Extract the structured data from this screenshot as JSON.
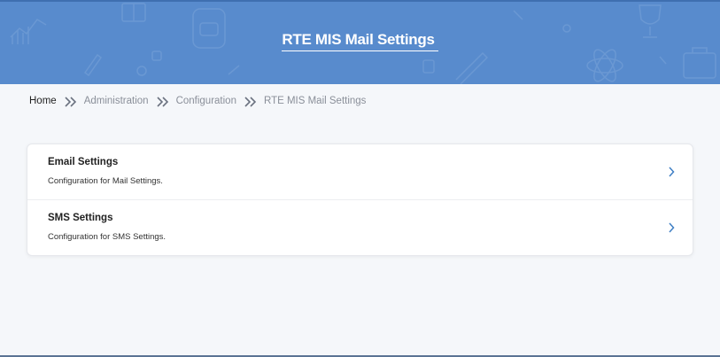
{
  "header": {
    "title": "RTE MIS Mail Settings",
    "background_color": "#588bcd"
  },
  "breadcrumb": {
    "items": [
      "Home",
      "Administration",
      "Configuration",
      "RTE MIS Mail Settings"
    ],
    "separator_icon": "double-chevron-right-icon"
  },
  "settings": {
    "items": [
      {
        "title": "Email Settings",
        "description": "Configuration for Mail Settings.",
        "icon": "chevron-right-icon"
      },
      {
        "title": "SMS Settings",
        "description": "Configuration for SMS Settings.",
        "icon": "chevron-right-icon"
      }
    ]
  },
  "colors": {
    "accent": "#3f7fc4",
    "page_background": "#f5f7fa"
  }
}
